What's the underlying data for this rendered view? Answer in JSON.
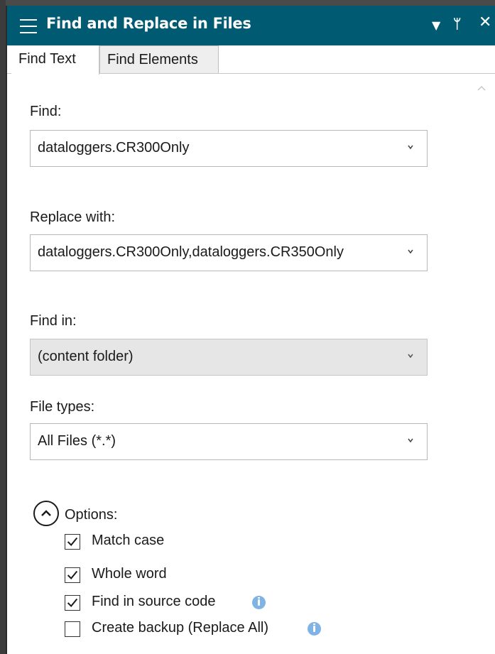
{
  "panel": {
    "title": "Find and Replace in Files",
    "accent_color": "#005a72"
  },
  "tabs": [
    {
      "label": "Find Text",
      "active": true
    },
    {
      "label": "Find Elements",
      "active": false
    }
  ],
  "find": {
    "label": "Find:",
    "value": "dataloggers.CR300Only"
  },
  "replace": {
    "label": "Replace with:",
    "value": "dataloggers.CR300Only,dataloggers.CR350Only"
  },
  "find_in": {
    "label": "Find in:",
    "value": "(content folder)"
  },
  "file_types": {
    "label": "File types:",
    "value": "All Files (*.*)"
  },
  "options": {
    "label": "Options:",
    "expanded": true,
    "items": [
      {
        "label": "Match case",
        "checked": true,
        "info": false
      },
      {
        "label": "Whole word",
        "checked": true,
        "info": false
      },
      {
        "label": "Find in source code",
        "checked": true,
        "info": true
      },
      {
        "label": "Create backup (Replace All)",
        "checked": false,
        "info": true
      }
    ]
  },
  "icons": {
    "menu": "hamburger-menu-icon",
    "dropdown": "triangle-down-icon",
    "pin": "pin-icon",
    "close": "close-icon",
    "combo_arrow": "chevron-down-icon",
    "options_toggle": "chevron-up-circle-icon",
    "info": "info-icon",
    "scroll_up": "scroll-up-icon"
  }
}
